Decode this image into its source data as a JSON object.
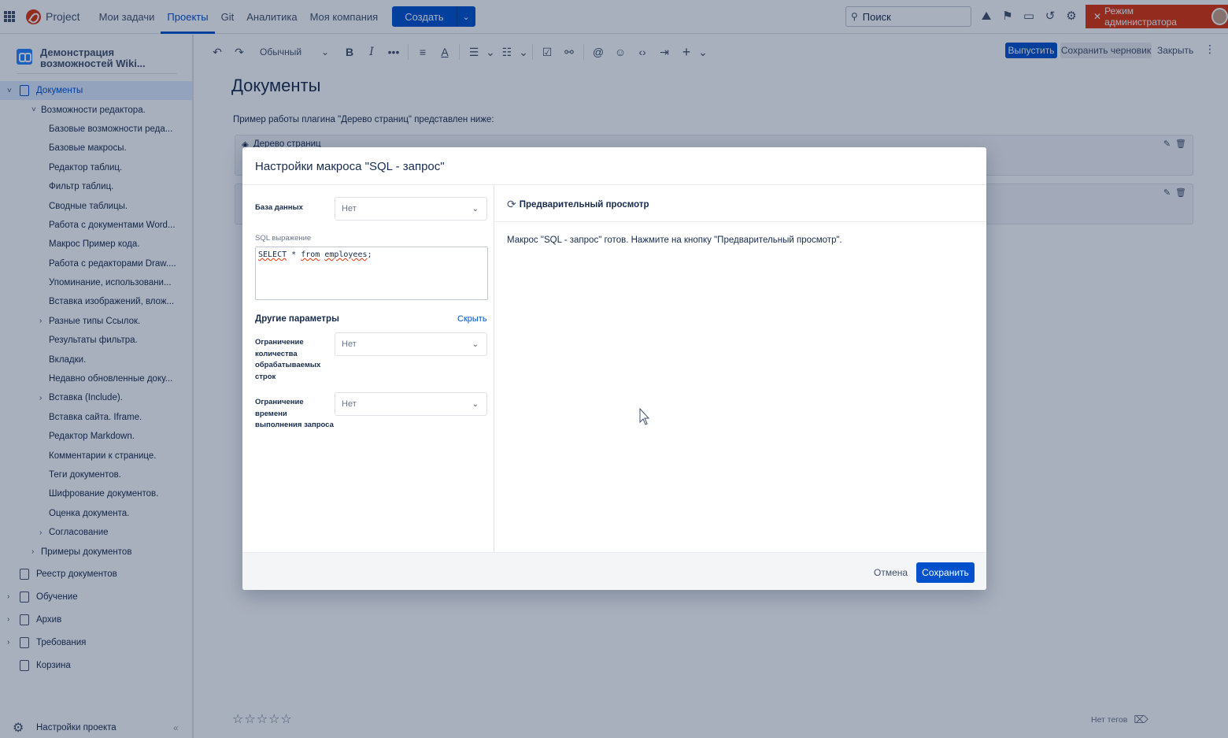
{
  "topbar": {
    "logo_text": "Project",
    "nav": [
      "Мои задачи",
      "Проекты",
      "Git",
      "Аналитика",
      "Моя компания"
    ],
    "active_nav": 1,
    "create_label": "Создать",
    "search_placeholder": "Поиск",
    "admin_label": "Режим администратора",
    "admin_color": "#de350b"
  },
  "sidebar": {
    "space_name_line1": "Демонстрация",
    "space_name_line2": "возможностей Wiki...",
    "tree": [
      {
        "label": "Документы",
        "level": 0,
        "chevron": "˅",
        "icon": true,
        "selected": true
      },
      {
        "label": "Возможности редактора.",
        "level": 1,
        "chevron": "˅"
      },
      {
        "label": "Базовые возможности реда...",
        "level": 2
      },
      {
        "label": "Базовые макросы.",
        "level": 2
      },
      {
        "label": "Редактор таблиц.",
        "level": 2
      },
      {
        "label": "Фильтр таблиц.",
        "level": 2
      },
      {
        "label": "Сводные таблицы.",
        "level": 2
      },
      {
        "label": "Работа с документами Word...",
        "level": 2
      },
      {
        "label": "Макрос Пример кода.",
        "level": 2
      },
      {
        "label": "Работа с редакторами Draw....",
        "level": 2
      },
      {
        "label": "Упоминание, использовани...",
        "level": 2
      },
      {
        "label": "Вставка изображений, влож...",
        "level": 2
      },
      {
        "label": "Разные типы Ссылок.",
        "level": 2,
        "chevron": "›"
      },
      {
        "label": "Результаты фильтра.",
        "level": 2
      },
      {
        "label": "Вкладки.",
        "level": 2
      },
      {
        "label": "Недавно обновленные доку...",
        "level": 2
      },
      {
        "label": "Вставка (Include).",
        "level": 2,
        "chevron": "›"
      },
      {
        "label": "Вставка сайта. Iframe.",
        "level": 2
      },
      {
        "label": "Редактор Markdown.",
        "level": 2
      },
      {
        "label": "Комментарии к странице.",
        "level": 2
      },
      {
        "label": "Теги документов.",
        "level": 2
      },
      {
        "label": "Шифрование документов.",
        "level": 2
      },
      {
        "label": "Оценка документа.",
        "level": 2
      },
      {
        "label": "Согласование",
        "level": 2,
        "chevron": "›"
      },
      {
        "label": "Примеры документов",
        "level": 1,
        "chevron": "›"
      }
    ],
    "roots": [
      {
        "label": "Реестр документов",
        "chevron": ""
      },
      {
        "label": "Обучение",
        "chevron": "›"
      },
      {
        "label": "Архив",
        "chevron": "›"
      },
      {
        "label": "Требования",
        "chevron": "›"
      },
      {
        "label": "Корзина",
        "chevron": ""
      }
    ],
    "footer_label": "Настройки проекта",
    "collapse_label": "«"
  },
  "editor": {
    "style_select": "Обычный",
    "publish_label": "Выпустить",
    "draft_label": "Сохранить черновик",
    "close_label": "Закрыть",
    "title": "Документы",
    "paragraph": "Пример работы плагина \"Дерево страниц\" представлен ниже:",
    "macro1_title": "Дерево страниц",
    "rating": "☆☆☆☆☆",
    "no_tags": "Нет тегов"
  },
  "modal": {
    "title": "Настройки макроса \"SQL - запрос\"",
    "db_label": "База данных",
    "db_value": "Нет",
    "sql_label": "SQL выражение",
    "sql_tokens": [
      "SELECT",
      " * ",
      "from",
      " ",
      "employees",
      ";"
    ],
    "other_title": "Другие параметры",
    "hide_label": "Скрыть",
    "rows_limit_label": "Ограничение количества обрабатываемых строк",
    "rows_limit_value": "Нет",
    "time_limit_label": "Ограничение времени выполнения запроса",
    "time_limit_value": "Нет",
    "preview_label": "Предварительный просмотр",
    "preview_text": "Макрос \"SQL - запрос\" готов. Нажмите на кнопку \"Предварительный просмотр\".",
    "cancel_label": "Отмена",
    "save_label": "Сохранить",
    "accent_color": "#0052cc"
  }
}
